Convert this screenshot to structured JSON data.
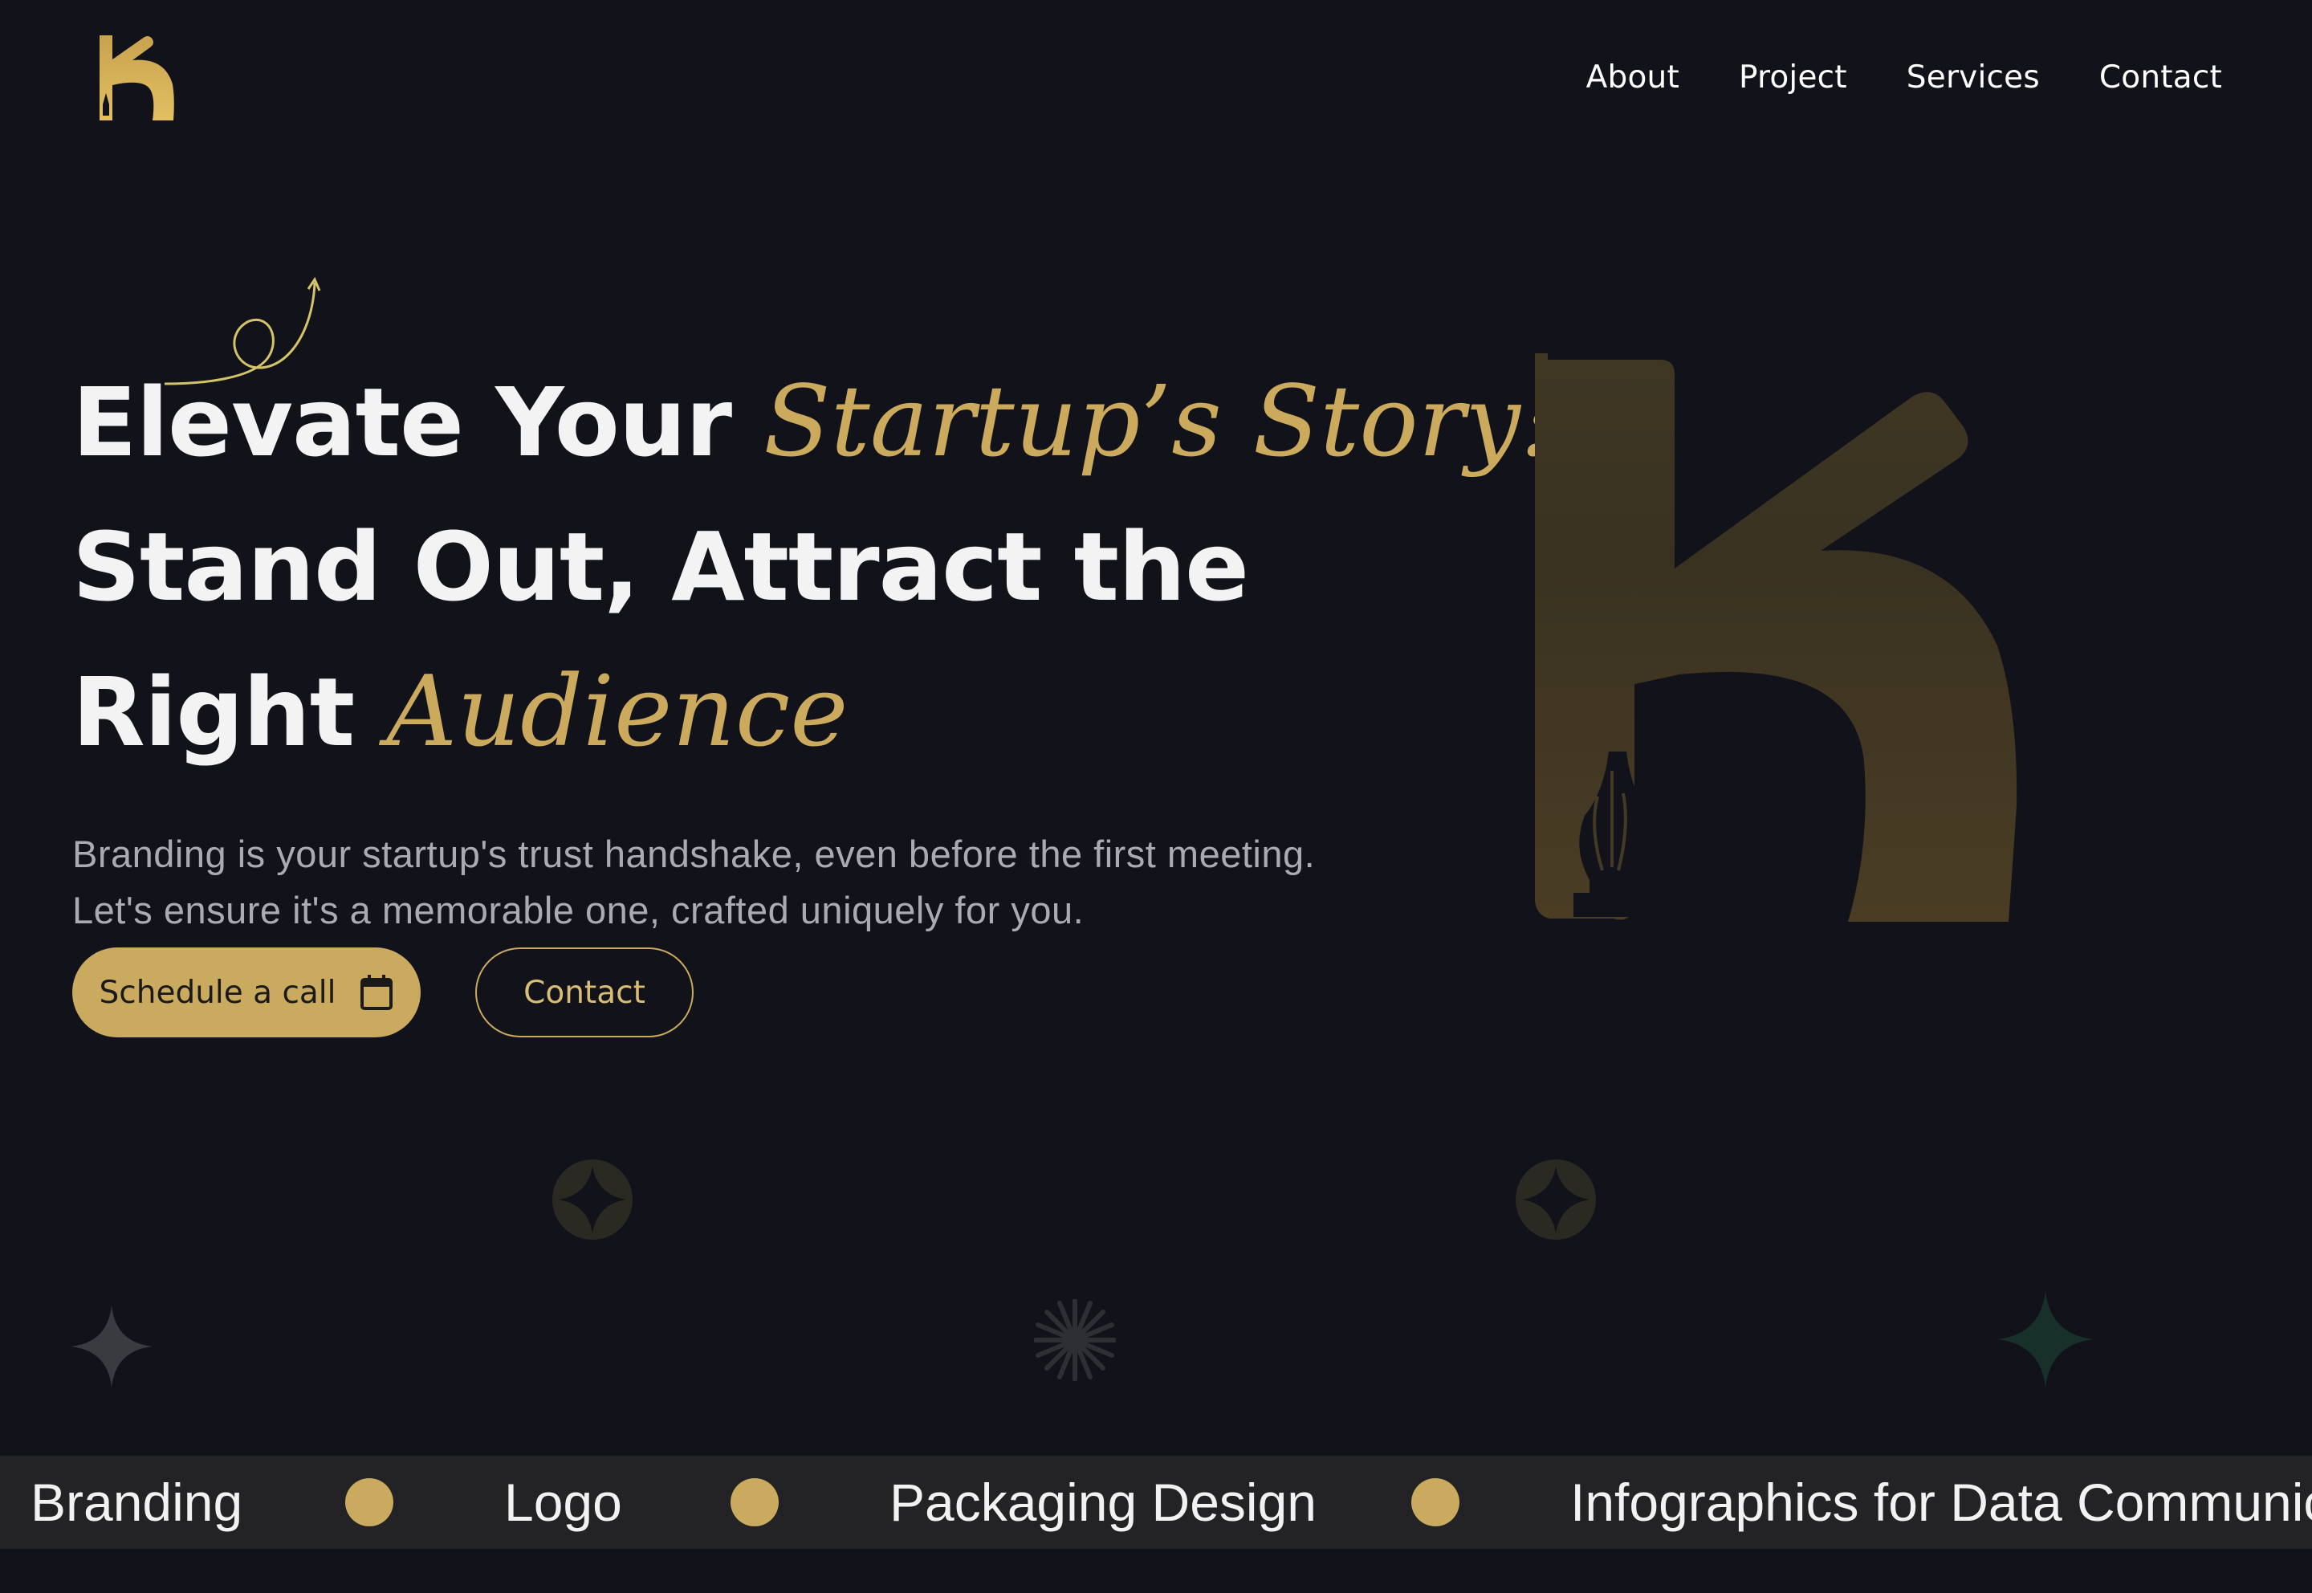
{
  "header": {
    "logo_icon": "k-pen-logo-icon",
    "nav": [
      {
        "label": "About"
      },
      {
        "label": "Project"
      },
      {
        "label": "Services"
      },
      {
        "label": "Contact"
      }
    ]
  },
  "hero": {
    "line1_bold": "Elevate Your",
    "line1_script": "Startup’s Story:",
    "line2_bold": "Stand Out, Attract the",
    "line3_bold": "Right",
    "line3_script": "Audience",
    "subtitle": "Branding is your startup's trust handshake, even before the first meeting. Let's ensure it's a memorable one, crafted uniquely for you.",
    "primary_button": {
      "label": "Schedule a call",
      "icon": "calendar-icon"
    },
    "secondary_button": {
      "label": "Contact"
    }
  },
  "ticker": {
    "items": [
      "Branding",
      "Logo",
      "Packaging Design",
      "Infographics for Data Communic"
    ]
  },
  "colors": {
    "background": "#12131a",
    "accent_gold": "#c9aa5e",
    "ticker_bg": "#232325",
    "subtitle_gray": "#a9abb2"
  }
}
